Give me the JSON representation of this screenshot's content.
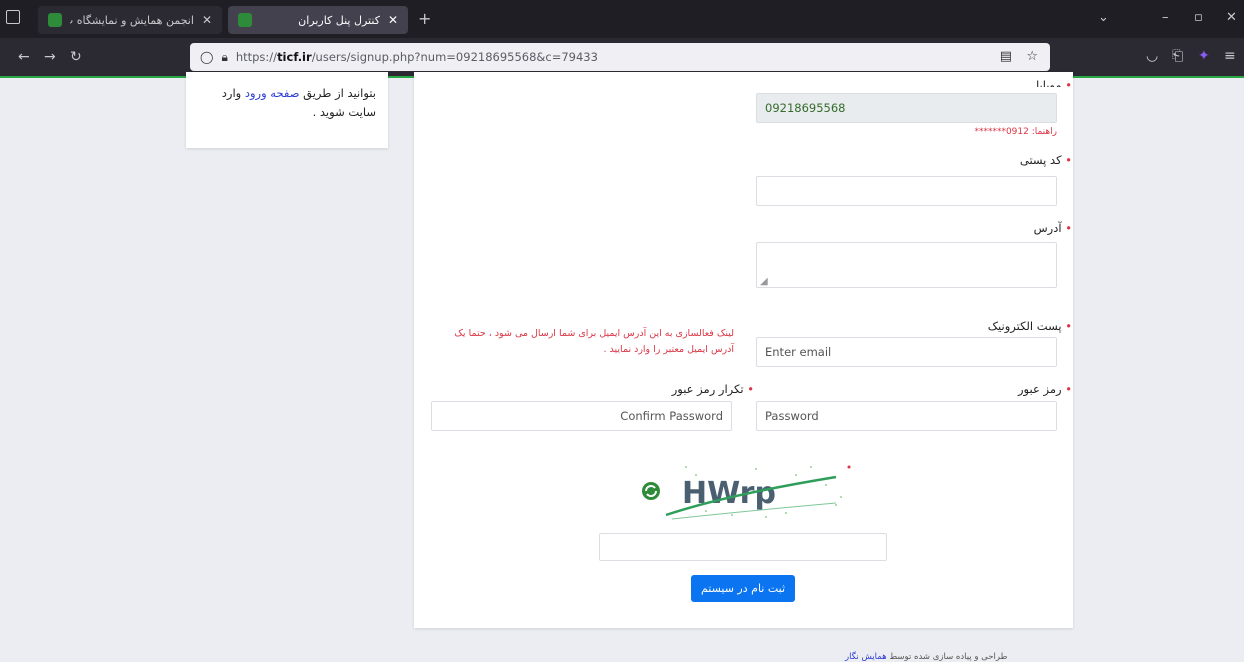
{
  "browser": {
    "tabs": [
      {
        "title": "انجمن همایش و نمایشگاه پ",
        "active": false
      },
      {
        "title": "کنترل پنل کاربران",
        "active": true
      }
    ],
    "url": {
      "prefix": "https://",
      "domain": "ticf.ir",
      "path": "/users/signup.php?num=09218695568&c=79433"
    }
  },
  "side_card": {
    "text_before": "بتوانید از طریق ",
    "link": "صفحه ورود",
    "text_after": " وارد سایت شوید ."
  },
  "form": {
    "mobile": {
      "label": "موبایل",
      "value": "09218695568",
      "hint": "راهنما: 0912*******"
    },
    "postal_code": {
      "label": "کد پستی",
      "value": ""
    },
    "address": {
      "label": "آدرس",
      "value": ""
    },
    "email": {
      "label": "پست الکترونیک",
      "placeholder": "Enter email",
      "note": "لینک فعالسازی به این آدرس ایمیل برای شما ارسال می شود ، حتما یک آدرس ایمیل معتبر را وارد نمایید ."
    },
    "password": {
      "label": "رمز عبور",
      "placeholder": "Password"
    },
    "confirm_password": {
      "label": "تکرار رمز عبور",
      "placeholder": "Confirm Password"
    },
    "captcha": {
      "text": "HWrp",
      "value": ""
    },
    "submit_label": "ثبت نام در سیستم"
  },
  "footer": {
    "text": "طراحی و پیاده سازی شده توسط ",
    "link": "همایش نگار"
  },
  "colors": {
    "accent": "#0b74f0",
    "required": "#dc3545",
    "readonly_bg": "#e9ecef"
  }
}
